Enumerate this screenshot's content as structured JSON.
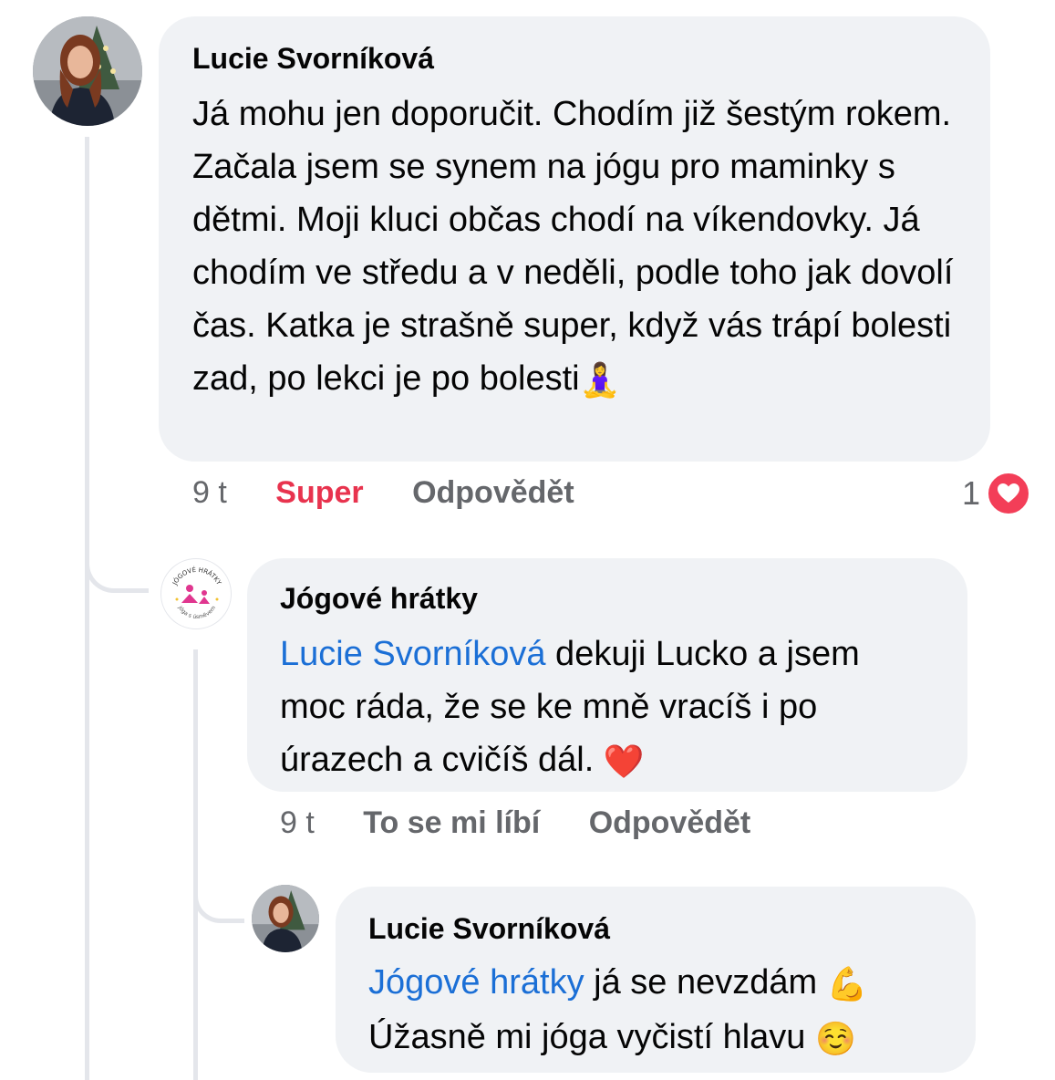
{
  "comments": [
    {
      "author": "Lucie Svorníková",
      "text": "Já mohu jen doporučit. Chodím již šestým rokem. Začala jsem se synem na jógu pro maminky s dětmi. Moji kluci občas chodí na víkendovky. Já chodím ve středu a v neděli, podle toho jak dovolí čas. Katka je strašně super, když vás trápí bolesti zad, po lekci je po bolesti",
      "emoji": "🧘‍♀️",
      "time": "9 t",
      "reaction_label": "Super",
      "reply_label": "Odpovědět",
      "reaction_count": "1",
      "reaction_icon": "heart-icon"
    },
    {
      "author": "Jógové hrátky",
      "mention": "Lucie Svorníková",
      "text": " dekuji Lucko a jsem moc ráda, že se ke mně vracíš i po úrazech a cvičíš dál. ",
      "emoji": "❤️",
      "time": "9 t",
      "like_label": "To se mi líbí",
      "reply_label": "Odpovědět",
      "logo_text_top": "JÓGOVÉ HRÁTKY",
      "logo_text_bottom": "jóga s úsměvem"
    },
    {
      "author": "Lucie Svorníková",
      "mention": "Jógové hrátky",
      "text_line1": " já se nevzdám ",
      "emoji1": "💪",
      "text_line2": "Úžasně mi jóga vyčistí hlavu ",
      "emoji2": "☺️"
    }
  ],
  "colors": {
    "mention": "#1b6fd6",
    "super": "#e8334e",
    "bubble": "#f0f2f5",
    "heart": "#f33e58"
  }
}
